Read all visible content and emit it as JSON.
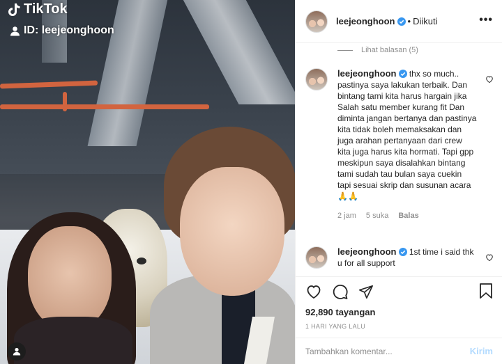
{
  "video": {
    "tiktok_logo_text": "TikTok",
    "tiktok_id_text": "ID: leejeonghoon"
  },
  "post": {
    "username": "leejeonghoon",
    "separator": "•",
    "follow_status": "Diikuti",
    "view_replies": "Lihat balasan (5)",
    "comments": [
      {
        "username": "leejeonghoon",
        "text": "thx so much.. pastinya saya lakukan terbaik. Dan bintang tami kita harus hargain jika Salah satu member kurang fit Dan diminta jangan bertanya dan pastinya kita tidak boleh memaksakan dan juga arahan pertanyaan dari crew kita juga harus kita hormati. Tapi gpp meskipun saya disalahkan bintang tami sudah tau bulan saya cuekin tapi sesuai skrip dan susunan acara🙏🙏",
        "time": "2 jam",
        "likes": "5 suka",
        "reply": "Balas"
      },
      {
        "username": "leejeonghoon",
        "text": "1st time i said thk u for all support"
      }
    ],
    "views": "92,890 tayangan",
    "posted_time": "1 HARI YANG LALU",
    "comment_placeholder": "Tambahkan komentar...",
    "post_button": "Kirim"
  },
  "colors": {
    "verified_blue": "#3897f0",
    "link_disabled": "#b3dbff",
    "muted_text": "#8e8e8e"
  },
  "icons": [
    "tiktok-icon",
    "user-icon",
    "verified-icon",
    "more-icon",
    "heart-icon",
    "comment-icon",
    "share-icon",
    "bookmark-icon",
    "tag-user-icon"
  ]
}
